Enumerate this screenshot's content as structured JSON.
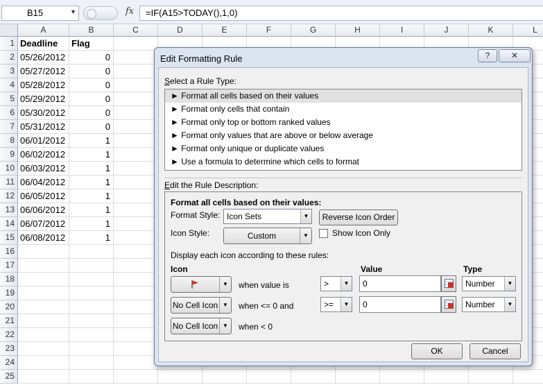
{
  "formula_bar": {
    "name_box": "B15",
    "fx_label": "fx",
    "formula": "=IF(A15>TODAY(),1,0)"
  },
  "sheet": {
    "columns": [
      "A",
      "B",
      "C",
      "D",
      "E",
      "F",
      "G",
      "H",
      "I",
      "J",
      "K",
      "L"
    ],
    "row_numbers": [
      "1",
      "2",
      "3",
      "4",
      "5",
      "6",
      "7",
      "8",
      "9",
      "10",
      "11",
      "12",
      "13",
      "14",
      "15",
      "16",
      "17",
      "18",
      "19",
      "20",
      "21",
      "22",
      "23",
      "24",
      "25"
    ],
    "header_row": {
      "a": "Deadline",
      "b": "Flag"
    },
    "data_rows": [
      {
        "date": "05/26/2012",
        "flag": "0",
        "icon": ""
      },
      {
        "date": "05/27/2012",
        "flag": "0",
        "icon": ""
      },
      {
        "date": "05/28/2012",
        "flag": "0",
        "icon": ""
      },
      {
        "date": "05/29/2012",
        "flag": "0",
        "icon": ""
      },
      {
        "date": "05/30/2012",
        "flag": "0",
        "icon": ""
      },
      {
        "date": "05/31/2012",
        "flag": "0",
        "icon": ""
      },
      {
        "date": "06/01/2012",
        "flag": "1",
        "icon": "red-flag-icon"
      },
      {
        "date": "06/02/2012",
        "flag": "1",
        "icon": "red-flag-icon"
      },
      {
        "date": "06/03/2012",
        "flag": "1",
        "icon": "red-flag-icon"
      },
      {
        "date": "06/04/2012",
        "flag": "1",
        "icon": "red-flag-icon"
      },
      {
        "date": "06/05/2012",
        "flag": "1",
        "icon": "red-flag-icon"
      },
      {
        "date": "06/06/2012",
        "flag": "1",
        "icon": "red-flag-icon"
      },
      {
        "date": "06/07/2012",
        "flag": "1",
        "icon": "red-flag-icon"
      },
      {
        "date": "06/08/2012",
        "flag": "1",
        "icon": "red-flag-icon"
      }
    ]
  },
  "dialog": {
    "title": "Edit Formatting Rule",
    "help_glyph": "?",
    "close_glyph": "✕",
    "select_rule_type_label": "Select a Rule Type:",
    "rule_types": [
      "► Format all cells based on their values",
      "► Format only cells that contain",
      "► Format only top or bottom ranked values",
      "► Format only values that are above or below average",
      "► Format only unique or duplicate values",
      "► Use a formula to determine which cells to format"
    ],
    "selected_rule_index": 0,
    "edit_description_label": "Edit the Rule Description:",
    "description_title": "Format all cells based on their values:",
    "format_style_label": "Format Style:",
    "format_style_value": "Icon Sets",
    "reverse_icon_order": "Reverse Icon Order",
    "icon_style_label": "Icon Style:",
    "icon_style_value": "Custom",
    "show_icon_only": "Show Icon Only",
    "show_icon_only_checked": false,
    "display_rules_label": "Display each icon according to these rules:",
    "col_icon": "Icon",
    "col_value": "Value",
    "col_type": "Type",
    "rules": [
      {
        "icon": "red-flag-icon",
        "icon_label": "",
        "condition": "when value is",
        "operator": ">",
        "value": "0",
        "type": "Number"
      },
      {
        "icon": "",
        "icon_label": "No Cell Icon",
        "condition": "when <= 0 and",
        "operator": ">=",
        "value": "0",
        "type": "Number"
      },
      {
        "icon": "",
        "icon_label": "No Cell Icon",
        "condition": "when < 0"
      }
    ],
    "ok": "OK",
    "cancel": "Cancel"
  }
}
